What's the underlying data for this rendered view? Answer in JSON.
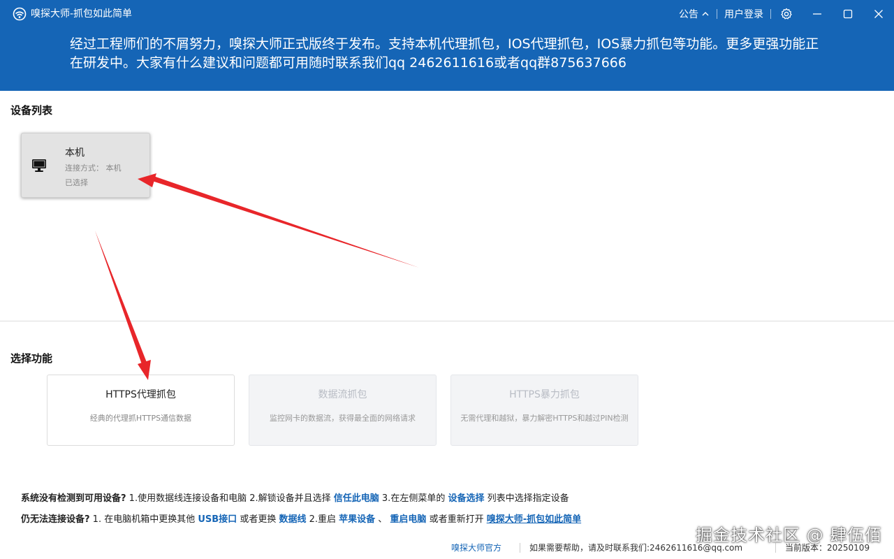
{
  "titlebar": {
    "app_title": "嗅探大师-抓包如此简单",
    "announce_label": "公告",
    "login_label": "用户登录"
  },
  "banner": {
    "text": "经过工程师们的不屑努力，嗅探大师正式版终于发布。支持本机代理抓包，IOS代理抓包，IOS暴力抓包等功能。更多更强功能正在研发中。大家有什么建议和问题都可用随时联系我们qq 2462611616或者qq群875637666"
  },
  "devices": {
    "title": "设备列表",
    "items": [
      {
        "name": "本机",
        "connection": "连接方式：  本机",
        "status": "已选择"
      }
    ]
  },
  "functions": {
    "title": "选择功能",
    "items": [
      {
        "title": "HTTPS代理抓包",
        "desc": "经典的代理抓HTTPS通信数据",
        "enabled": true
      },
      {
        "title": "数据流抓包",
        "desc": "监控网卡的数据流，获得最全面的网络请求",
        "enabled": false
      },
      {
        "title": "HTTPS暴力抓包",
        "desc": "无需代理和越狱，暴力解密HTTPS和越过PIN检测",
        "enabled": false
      }
    ]
  },
  "help": {
    "line1": {
      "question": "系统没有检测到可用设备?",
      "step1": " 1.使用数据线连接设备和电脑  2.解锁设备并且选择 ",
      "link1": "信任此电脑",
      "step3": "  3.在左侧菜单的 ",
      "link2": "设备选择",
      "step3_end": " 列表中选择指定设备"
    },
    "line2": {
      "question": "仍无法连接设备?",
      "step1": " 1. 在电脑机箱中更换其他 ",
      "link1": "USB接口",
      "mid1": " 或者更换 ",
      "link2": "数据线",
      "mid2": "   2.重启 ",
      "link3": "苹果设备",
      "mid3": " 、 ",
      "link4": "重启电脑",
      "mid4": " 或者重新打开 ",
      "link5": "嗅探大师-抓包如此简单"
    }
  },
  "footer": {
    "official_link": "嗅探大师官方",
    "contact": "如果需要帮助，请及时联系我们:2462611616@qq.com",
    "version": "当前版本：20250109"
  },
  "watermark": "掘金技术社区 @ 肆伍佰",
  "colors": {
    "brand_blue": "#1565b6",
    "annotation_red": "#e8262a"
  }
}
